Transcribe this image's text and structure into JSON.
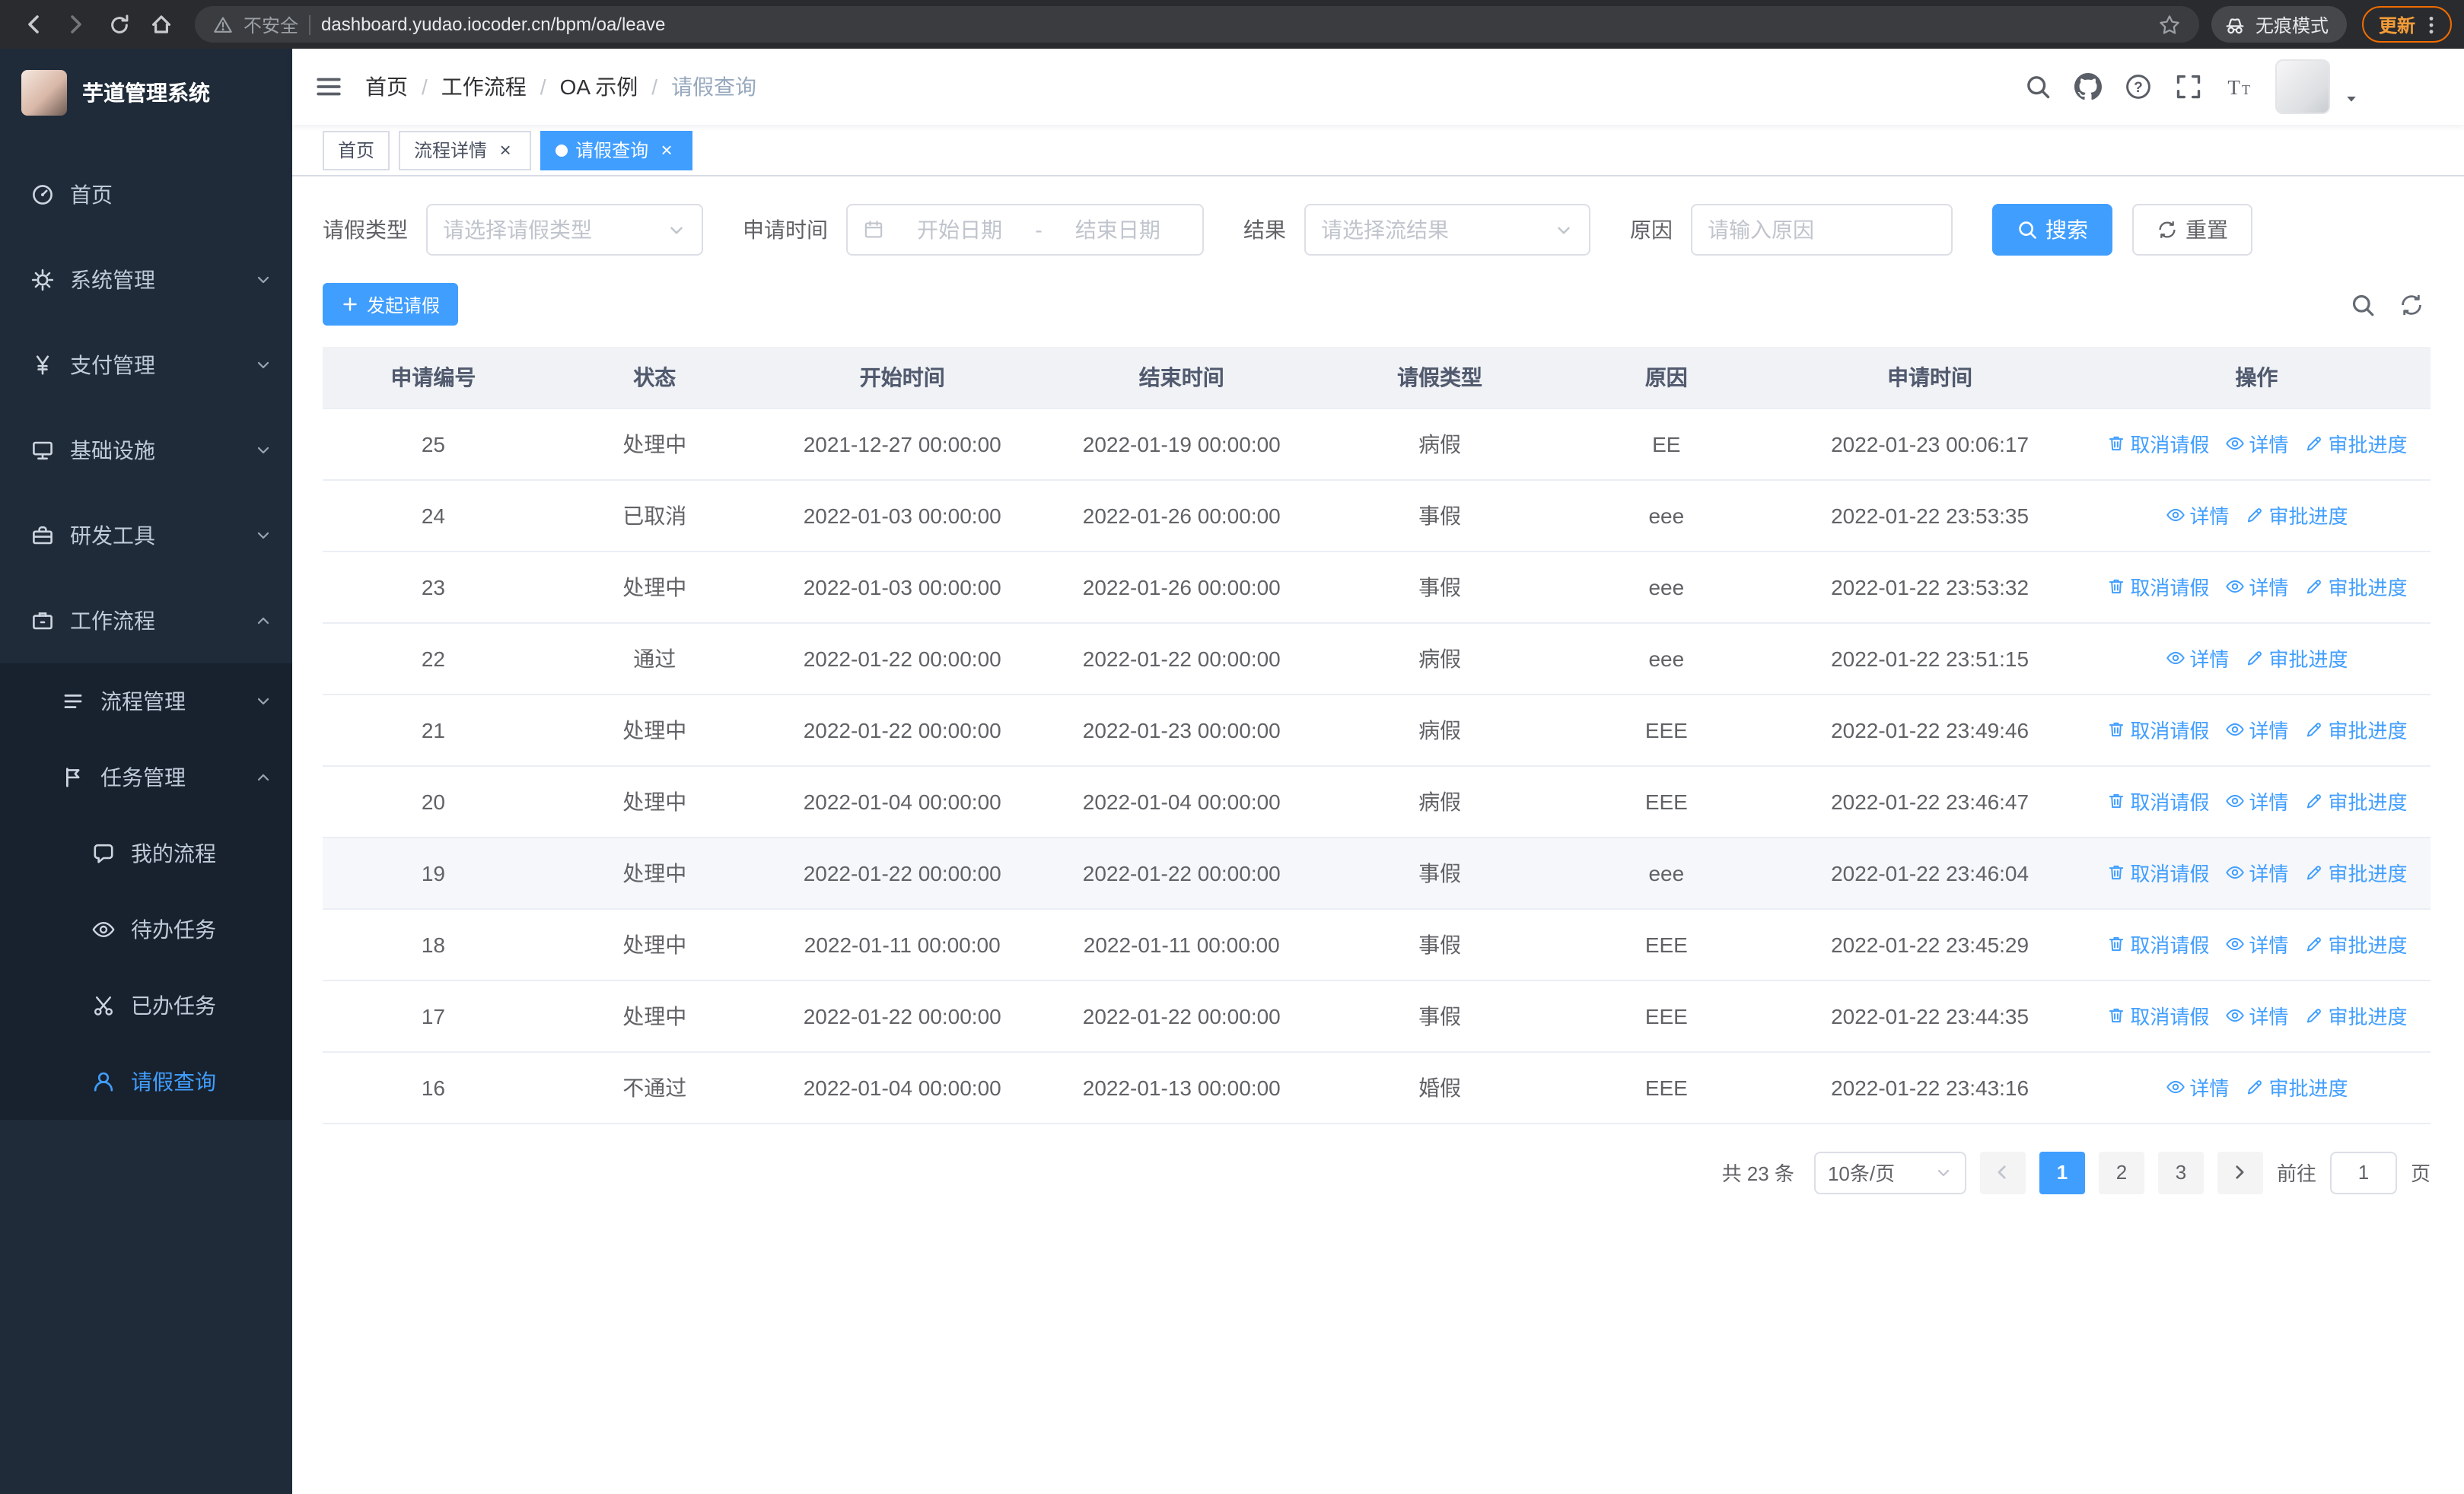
{
  "browser": {
    "security_label": "不安全",
    "url": "dashboard.yudao.iocoder.cn/bpm/oa/leave",
    "incognito_label": "无痕模式",
    "update_label": "更新"
  },
  "sidebar": {
    "logo_title": "芋道管理系统",
    "menu": [
      {
        "name": "home",
        "label": "首页",
        "icon": "dashboard"
      },
      {
        "name": "system-management",
        "label": "系统管理",
        "icon": "gear",
        "expandable": true
      },
      {
        "name": "payment-management",
        "label": "支付管理",
        "icon": "yen",
        "expandable": true
      },
      {
        "name": "infrastructure",
        "label": "基础设施",
        "icon": "infra",
        "expandable": true
      },
      {
        "name": "dev-tools",
        "label": "研发工具",
        "icon": "toolbox",
        "expandable": true
      },
      {
        "name": "workflow",
        "label": "工作流程",
        "icon": "briefcase",
        "expandable": true,
        "expanded": true,
        "children": [
          {
            "name": "process-management",
            "label": "流程管理",
            "icon": "list",
            "expandable": true
          },
          {
            "name": "task-management",
            "label": "任务管理",
            "icon": "flag",
            "expandable": true,
            "expanded": true,
            "children": [
              {
                "name": "my-process",
                "label": "我的流程",
                "icon": "chat"
              },
              {
                "name": "todo-tasks",
                "label": "待办任务",
                "icon": "eye"
              },
              {
                "name": "done-tasks",
                "label": "已办任务",
                "icon": "scissors"
              },
              {
                "name": "leave-query",
                "label": "请假查询",
                "icon": "user",
                "active": true
              }
            ]
          }
        ]
      }
    ]
  },
  "header": {
    "breadcrumb": [
      {
        "label": "首页"
      },
      {
        "label": "工作流程"
      },
      {
        "label": "OA 示例"
      },
      {
        "label": "请假查询",
        "current": true
      }
    ]
  },
  "tabs": [
    {
      "name": "home",
      "label": "首页"
    },
    {
      "name": "process-detail",
      "label": "流程详情",
      "closable": true
    },
    {
      "name": "leave-query",
      "label": "请假查询",
      "closable": true,
      "active": true
    }
  ],
  "filters": {
    "leave_type": {
      "label": "请假类型",
      "placeholder": "请选择请假类型"
    },
    "apply_time": {
      "label": "申请时间",
      "start_placeholder": "开始日期",
      "separator": "-",
      "end_placeholder": "结束日期"
    },
    "result": {
      "label": "结果",
      "placeholder": "请选择流结果"
    },
    "reason": {
      "label": "原因",
      "placeholder": "请输入原因"
    },
    "search_label": "搜索",
    "reset_label": "重置"
  },
  "toolbar": {
    "create_label": "发起请假"
  },
  "table": {
    "columns": [
      "申请编号",
      "状态",
      "开始时间",
      "结束时间",
      "请假类型",
      "原因",
      "申请时间",
      "操作"
    ],
    "action_defs": {
      "cancel": {
        "label": "取消请假",
        "icon": "delete"
      },
      "detail": {
        "label": "详情",
        "icon": "eye"
      },
      "progress": {
        "label": "审批进度",
        "icon": "edit"
      }
    },
    "rows": [
      {
        "no": "25",
        "status": "处理中",
        "start": "2021-12-27 00:00:00",
        "end": "2022-01-19 00:00:00",
        "type": "病假",
        "reason": "EE",
        "apply_time": "2022-01-23 00:06:17",
        "actions": [
          "cancel",
          "detail",
          "progress"
        ]
      },
      {
        "no": "24",
        "status": "已取消",
        "start": "2022-01-03 00:00:00",
        "end": "2022-01-26 00:00:00",
        "type": "事假",
        "reason": "eee",
        "apply_time": "2022-01-22 23:53:35",
        "actions": [
          "detail",
          "progress"
        ]
      },
      {
        "no": "23",
        "status": "处理中",
        "start": "2022-01-03 00:00:00",
        "end": "2022-01-26 00:00:00",
        "type": "事假",
        "reason": "eee",
        "apply_time": "2022-01-22 23:53:32",
        "actions": [
          "cancel",
          "detail",
          "progress"
        ]
      },
      {
        "no": "22",
        "status": "通过",
        "start": "2022-01-22 00:00:00",
        "end": "2022-01-22 00:00:00",
        "type": "病假",
        "reason": "eee",
        "apply_time": "2022-01-22 23:51:15",
        "actions": [
          "detail",
          "progress"
        ]
      },
      {
        "no": "21",
        "status": "处理中",
        "start": "2022-01-22 00:00:00",
        "end": "2022-01-23 00:00:00",
        "type": "病假",
        "reason": "EEE",
        "apply_time": "2022-01-22 23:49:46",
        "actions": [
          "cancel",
          "detail",
          "progress"
        ]
      },
      {
        "no": "20",
        "status": "处理中",
        "start": "2022-01-04 00:00:00",
        "end": "2022-01-04 00:00:00",
        "type": "病假",
        "reason": "EEE",
        "apply_time": "2022-01-22 23:46:47",
        "actions": [
          "cancel",
          "detail",
          "progress"
        ]
      },
      {
        "no": "19",
        "status": "处理中",
        "start": "2022-01-22 00:00:00",
        "end": "2022-01-22 00:00:00",
        "type": "事假",
        "reason": "eee",
        "apply_time": "2022-01-22 23:46:04",
        "actions": [
          "cancel",
          "detail",
          "progress"
        ],
        "highlighted": true
      },
      {
        "no": "18",
        "status": "处理中",
        "start": "2022-01-11 00:00:00",
        "end": "2022-01-11 00:00:00",
        "type": "事假",
        "reason": "EEE",
        "apply_time": "2022-01-22 23:45:29",
        "actions": [
          "cancel",
          "detail",
          "progress"
        ]
      },
      {
        "no": "17",
        "status": "处理中",
        "start": "2022-01-22 00:00:00",
        "end": "2022-01-22 00:00:00",
        "type": "事假",
        "reason": "EEE",
        "apply_time": "2022-01-22 23:44:35",
        "actions": [
          "cancel",
          "detail",
          "progress"
        ]
      },
      {
        "no": "16",
        "status": "不通过",
        "start": "2022-01-04 00:00:00",
        "end": "2022-01-13 00:00:00",
        "type": "婚假",
        "reason": "EEE",
        "apply_time": "2022-01-22 23:43:16",
        "actions": [
          "detail",
          "progress"
        ]
      }
    ]
  },
  "pagination": {
    "total_label": "共 23 条",
    "page_size": "10条/页",
    "pages": [
      {
        "label": "1",
        "active": true
      },
      {
        "label": "2"
      },
      {
        "label": "3"
      }
    ],
    "goto_prefix": "前往",
    "goto_value": "1",
    "goto_suffix": "页"
  }
}
